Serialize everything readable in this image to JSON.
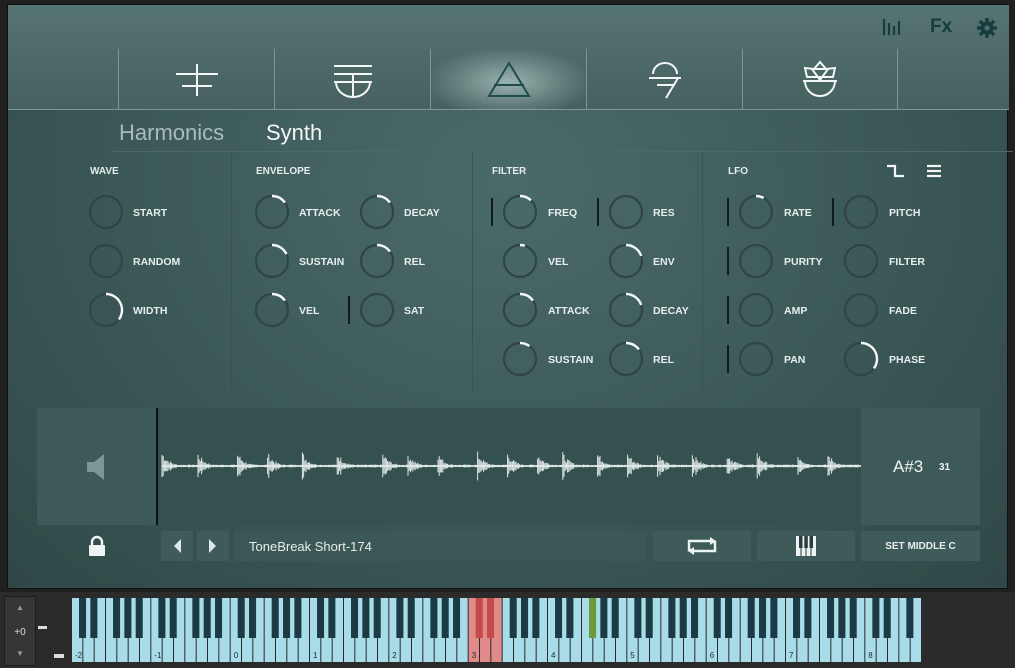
{
  "top_icons": {
    "mixer": "mixer-bars-icon",
    "fx": "Fx",
    "settings": "gear-icon"
  },
  "tabs": [
    {
      "name": "tab-source",
      "icon": "source-glyph-icon"
    },
    {
      "name": "tab-sampler",
      "icon": "sampler-glyph-icon"
    },
    {
      "name": "tab-synth",
      "icon": "triangle-glyph-icon",
      "active": true
    },
    {
      "name": "tab-effects",
      "icon": "effects-glyph-icon"
    },
    {
      "name": "tab-mandala",
      "icon": "mandala-glyph-icon"
    }
  ],
  "subtabs": {
    "harmonics": "Harmonics",
    "synth": "Synth"
  },
  "sections": {
    "wave": "WAVE",
    "envelope": "ENVELOPE",
    "filter": "FILTER",
    "lfo": "LFO"
  },
  "knobs": {
    "wave_start": {
      "label": "START",
      "value": 0.0
    },
    "wave_random": {
      "label": "RANDOM",
      "value": 0.0
    },
    "wave_width": {
      "label": "WIDTH",
      "value": 0.35
    },
    "env_attack": {
      "label": "ATTACK",
      "value": 0.15
    },
    "env_decay": {
      "label": "DECAY",
      "value": 0.15
    },
    "env_sustain": {
      "label": "SUSTAIN",
      "value": 0.18
    },
    "env_rel": {
      "label": "REL",
      "value": 0.15
    },
    "env_vel": {
      "label": "VEL",
      "value": 0.15
    },
    "env_sat": {
      "label": "SAT",
      "value": 0.0
    },
    "filter_freq": {
      "label": "FREQ",
      "value": 0.12
    },
    "filter_res": {
      "label": "RES",
      "value": 0.0
    },
    "filter_vel": {
      "label": "VEL",
      "value": 0.05
    },
    "filter_env": {
      "label": "ENV",
      "value": 0.2
    },
    "filter_attack": {
      "label": "ATTACK",
      "value": 0.15
    },
    "filter_decay": {
      "label": "DECAY",
      "value": 0.2
    },
    "filter_sustain": {
      "label": "SUSTAIN",
      "value": 0.1
    },
    "filter_rel": {
      "label": "REL",
      "value": 0.15
    },
    "lfo_rate": {
      "label": "RATE",
      "value": 0.08
    },
    "lfo_pitch": {
      "label": "PITCH",
      "value": 0.0
    },
    "lfo_purity": {
      "label": "PURITY",
      "value": 0.0
    },
    "lfo_filter": {
      "label": "FILTER",
      "value": 0.0
    },
    "lfo_amp": {
      "label": "AMP",
      "value": 0.0
    },
    "lfo_fade": {
      "label": "FADE",
      "value": 0.0
    },
    "lfo_pan": {
      "label": "PAN",
      "value": 0.0
    },
    "lfo_phase": {
      "label": "PHASE",
      "value": 0.35
    }
  },
  "lfo_shape_icon": "square-wave-icon",
  "lfo_menu_icon": "menu-lines-icon",
  "sample": {
    "name": "ToneBreak Short-174",
    "note": "A#3",
    "note_number": "31"
  },
  "buttons": {
    "set_middle_c": "SET MIDDLE C",
    "loop": "loop-icon",
    "keyboard": "piano-keys-icon",
    "prev": "prev-arrow-icon",
    "next": "next-arrow-icon",
    "lock": "lock-icon",
    "speaker": "speaker-icon"
  },
  "keyboard": {
    "transpose": "+0",
    "octave_labels": [
      "-2",
      "-1",
      "0",
      "1",
      "2",
      "3",
      "4",
      "5",
      "6",
      "7",
      "8"
    ]
  },
  "colors": {
    "accent": "#1f4d4d",
    "key_active": "#a8dce8",
    "key_range": "#e08a8a",
    "key_marker": "#6a9a3a"
  }
}
